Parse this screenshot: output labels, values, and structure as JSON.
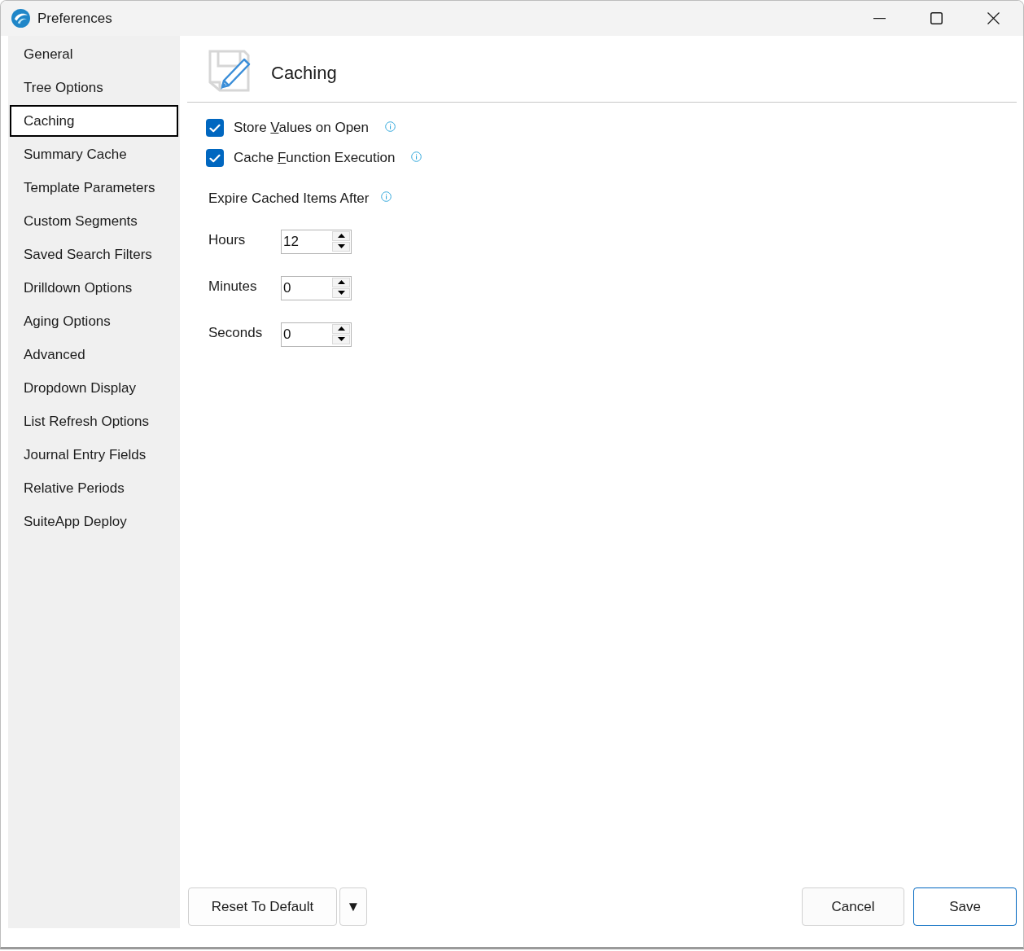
{
  "window": {
    "title": "Preferences"
  },
  "sidebar": {
    "items": [
      {
        "label": "General",
        "selected": false
      },
      {
        "label": "Tree Options",
        "selected": false
      },
      {
        "label": "Caching",
        "selected": true
      },
      {
        "label": "Summary Cache",
        "selected": false
      },
      {
        "label": "Template Parameters",
        "selected": false
      },
      {
        "label": "Custom Segments",
        "selected": false
      },
      {
        "label": "Saved Search Filters",
        "selected": false
      },
      {
        "label": "Drilldown Options",
        "selected": false
      },
      {
        "label": "Aging Options",
        "selected": false
      },
      {
        "label": "Advanced",
        "selected": false
      },
      {
        "label": "Dropdown Display",
        "selected": false
      },
      {
        "label": "List Refresh Options",
        "selected": false
      },
      {
        "label": "Journal Entry Fields",
        "selected": false
      },
      {
        "label": "Relative Periods",
        "selected": false
      },
      {
        "label": "SuiteApp Deploy",
        "selected": false
      }
    ]
  },
  "page": {
    "title": "Caching"
  },
  "options": [
    {
      "kind": "checkbox",
      "label_before": "Store ",
      "access_key": "V",
      "label_after": "alues on Open",
      "checked": true
    },
    {
      "kind": "checkbox",
      "label_before": "Cache ",
      "access_key": "F",
      "label_after": "unction Execution",
      "checked": true
    }
  ],
  "expire": {
    "label": "Expire Cached Items After",
    "fields": [
      {
        "label": "Hours",
        "value": "12"
      },
      {
        "label": "Minutes",
        "value": "0"
      },
      {
        "label": "Seconds",
        "value": "0"
      }
    ]
  },
  "footer": {
    "reset": {
      "label": "Reset To Default",
      "menu_glyph": "▼"
    },
    "buttons": [
      {
        "label": "Cancel",
        "default": false
      },
      {
        "label": "Save",
        "default": true
      }
    ]
  }
}
